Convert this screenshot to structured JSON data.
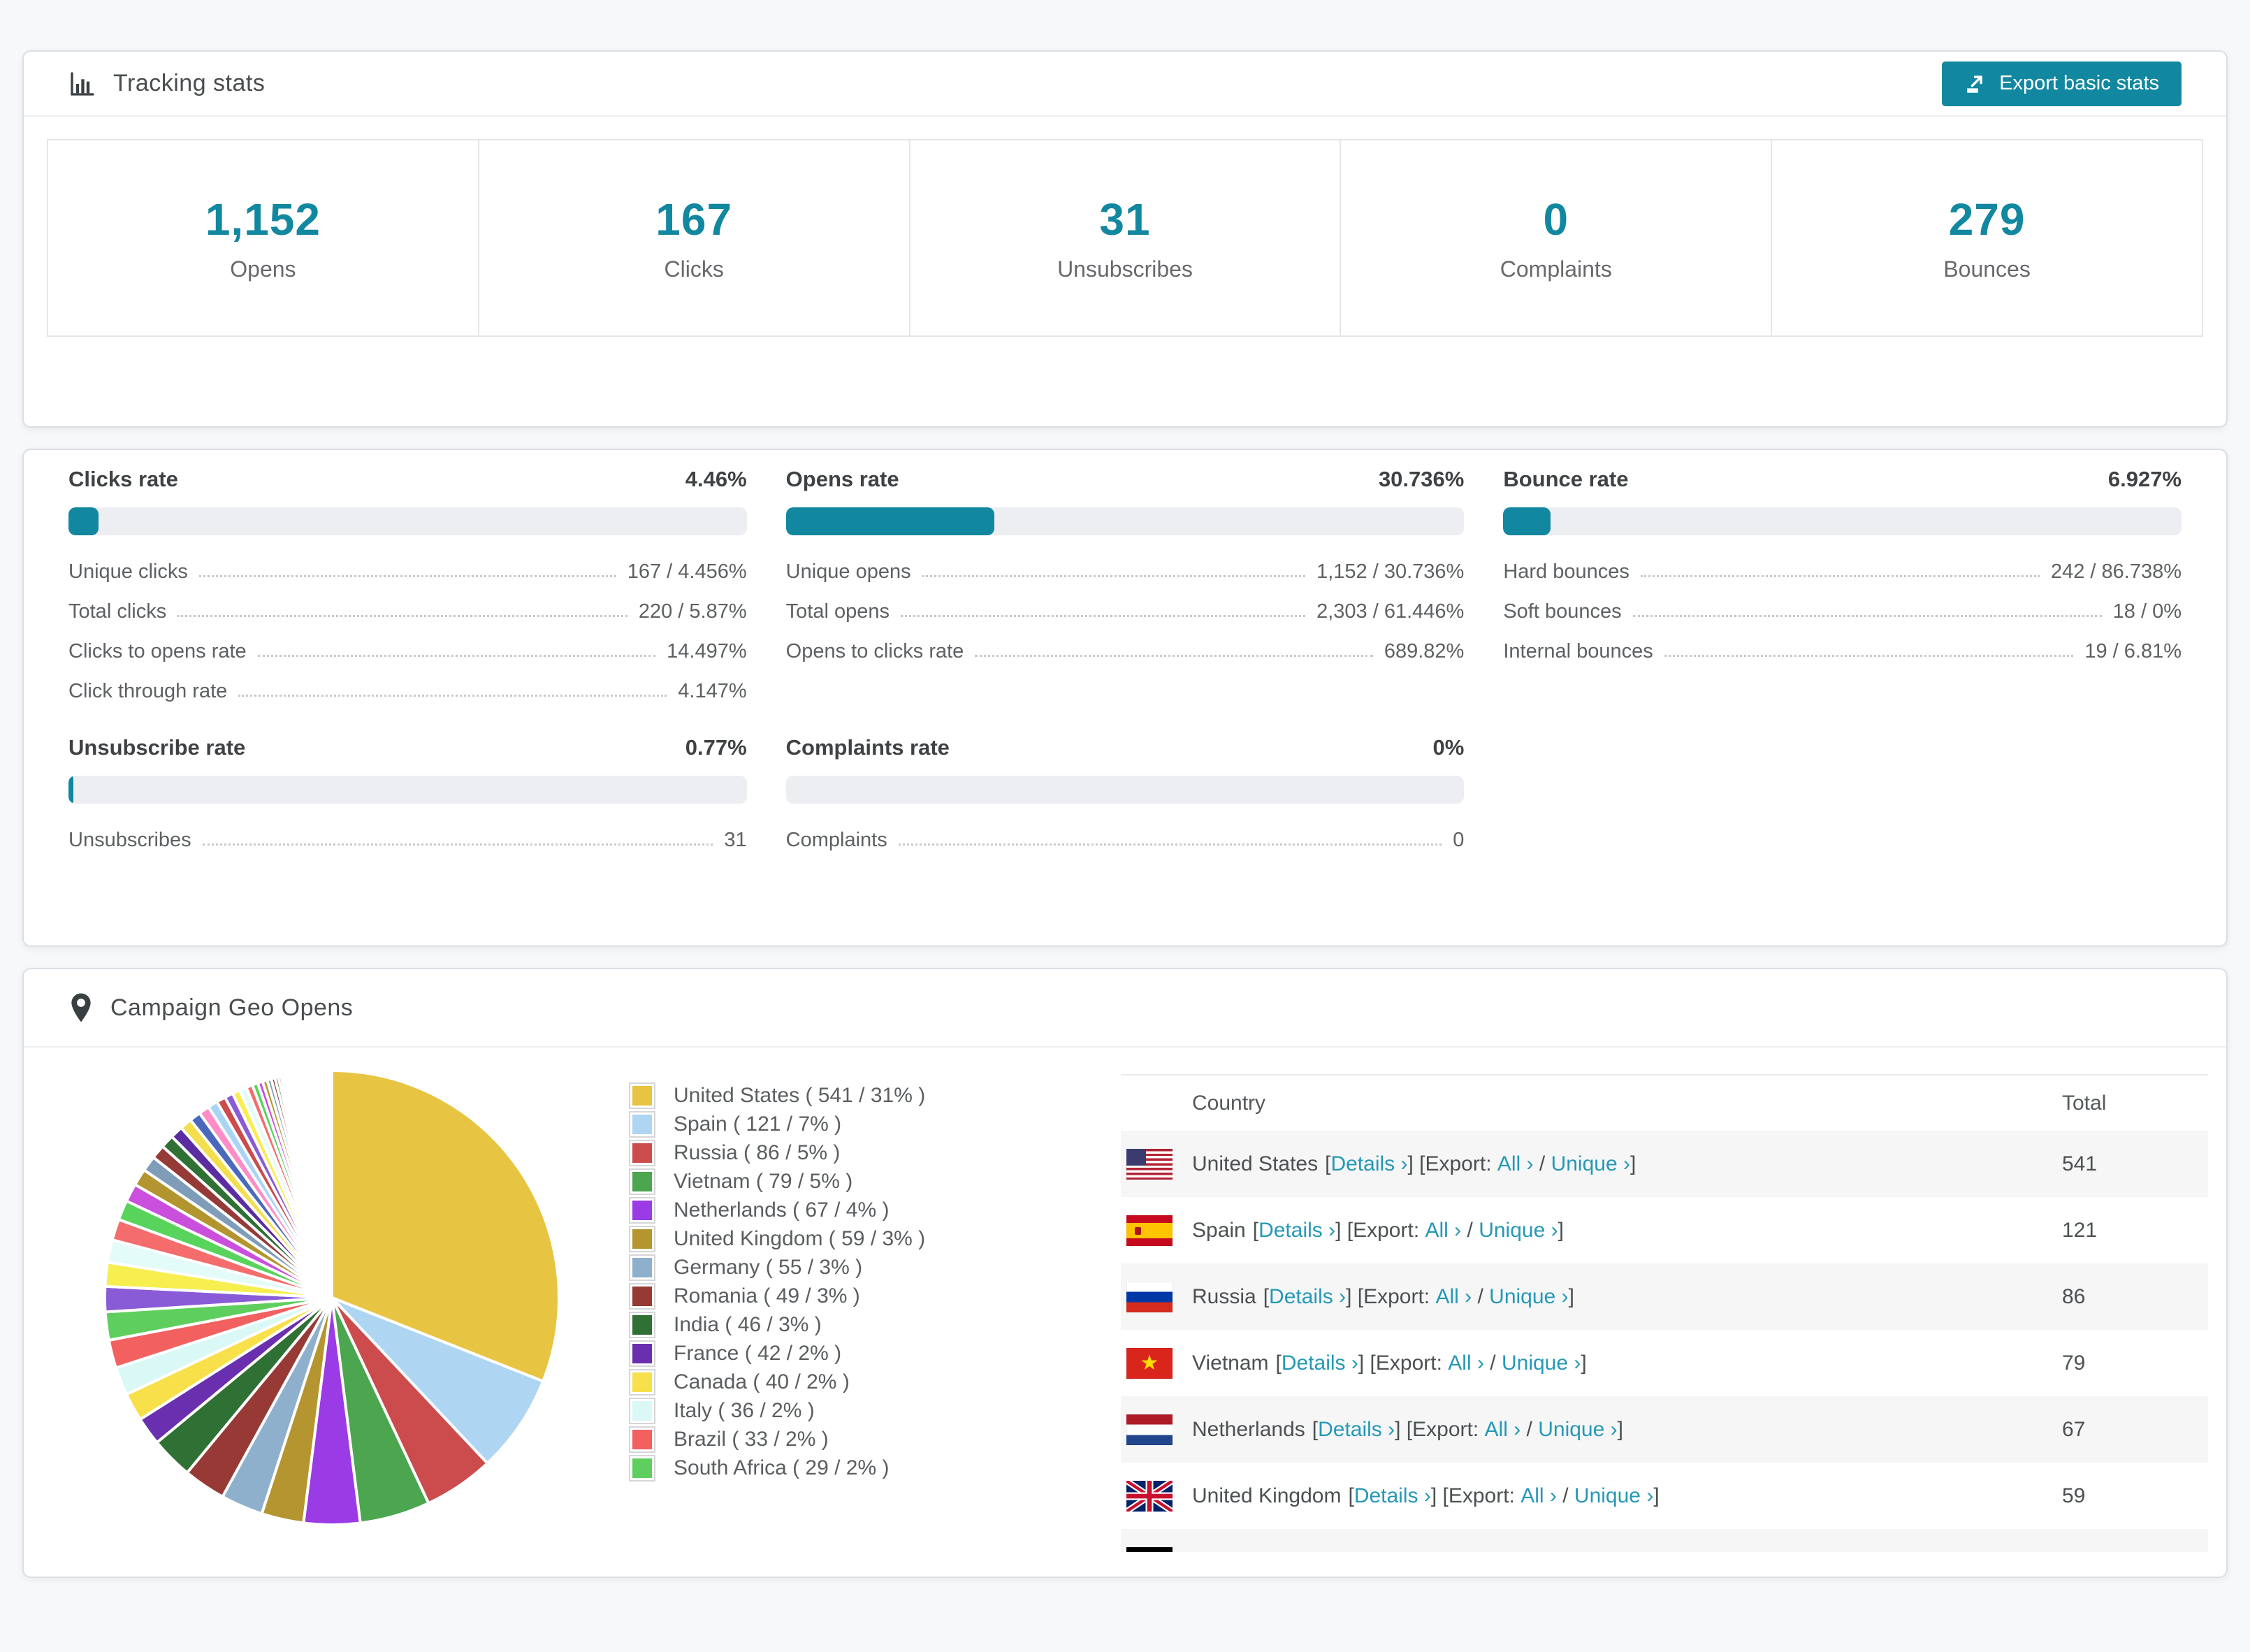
{
  "accent_color": "#1287a0",
  "page_bg": "#f7f8f9",
  "tracking": {
    "title": "Tracking stats",
    "icon": "bar-chart-icon",
    "export_button": "Export basic stats",
    "stats": [
      {
        "value": "1,152",
        "label": "Opens"
      },
      {
        "value": "167",
        "label": "Clicks"
      },
      {
        "value": "31",
        "label": "Unsubscribes"
      },
      {
        "value": "0",
        "label": "Complaints"
      },
      {
        "value": "279",
        "label": "Bounces"
      }
    ]
  },
  "rates": {
    "blocks": [
      {
        "title": "Clicks rate",
        "value": "4.46%",
        "percent": 4.46,
        "rows": [
          [
            "Unique clicks",
            "167 / 4.456%"
          ],
          [
            "Total clicks",
            "220 / 5.87%"
          ],
          [
            "Clicks to opens rate",
            "14.497%"
          ],
          [
            "Click through rate",
            "4.147%"
          ]
        ]
      },
      {
        "title": "Opens rate",
        "value": "30.736%",
        "percent": 30.736,
        "rows": [
          [
            "Unique opens",
            "1,152 / 30.736%"
          ],
          [
            "Total opens",
            "2,303 / 61.446%"
          ],
          [
            "Opens to clicks rate",
            "689.82%"
          ]
        ]
      },
      {
        "title": "Bounce rate",
        "value": "6.927%",
        "percent": 6.927,
        "rows": [
          [
            "Hard bounces",
            "242 / 86.738%"
          ],
          [
            "Soft bounces",
            "18 / 0%"
          ],
          [
            "Internal bounces",
            "19 / 6.81%"
          ]
        ]
      },
      {
        "title": "Unsubscribe rate",
        "value": "0.77%",
        "percent": 0.77,
        "rows": [
          [
            "Unsubscribes",
            "31"
          ]
        ]
      },
      {
        "title": "Complaints rate",
        "value": "0%",
        "percent": 0,
        "rows": [
          [
            "Complaints",
            "0"
          ]
        ]
      }
    ]
  },
  "geo": {
    "title": "Campaign Geo Opens",
    "icon": "map-pin-icon",
    "chart_data": {
      "type": "pie",
      "title": "Campaign Geo Opens",
      "legend_position": "right",
      "start_angle_deg": -90,
      "direction": "clockwise",
      "labels": [
        "United States",
        "Spain",
        "Russia",
        "Vietnam",
        "Netherlands",
        "United Kingdom",
        "Germany",
        "Romania",
        "India",
        "France",
        "Canada",
        "Italy",
        "Brazil",
        "South Africa"
      ],
      "values": [
        541,
        121,
        86,
        79,
        67,
        59,
        55,
        49,
        46,
        42,
        40,
        36,
        33,
        29
      ],
      "percents": [
        31,
        7,
        5,
        5,
        4,
        3,
        3,
        3,
        3,
        2,
        2,
        2,
        2,
        2
      ],
      "colors": [
        "#e8c443",
        "#aed5f2",
        "#cc4b4c",
        "#4ba64f",
        "#9a3be6",
        "#b5952f",
        "#8fb0cd",
        "#973a36",
        "#2f7034",
        "#6a2fae",
        "#f7e04a",
        "#d9f8f6",
        "#f26060",
        "#5ecf5e"
      ],
      "other_slices_note": "many small unlabeled slices tapering toward 12 o'clock, ~25% of pie total",
      "other_values": [
        1.8,
        1.7,
        1.6,
        1.5,
        1.4,
        1.3,
        1.2,
        1.1,
        1.0,
        0.95,
        0.9,
        0.85,
        0.8,
        0.75,
        0.7,
        0.65,
        0.6,
        0.55,
        0.5,
        0.45,
        0.4,
        0.36,
        0.33,
        0.3,
        0.27,
        0.24,
        0.21,
        0.19,
        0.17,
        0.15,
        0.13,
        0.11,
        0.1,
        0.09,
        0.08,
        0.07,
        0.06,
        0.05,
        0.05,
        0.04,
        0.04,
        0.03,
        0.03,
        0.02,
        0.02,
        0.02
      ],
      "other_colors": [
        "#8a5bd6",
        "#f7ee4f",
        "#e3fbf9",
        "#f46c6c",
        "#58d35b",
        "#cb4fdd",
        "#b3952f",
        "#7f9db9",
        "#963a38",
        "#2f7034",
        "#5b2da0",
        "#f3df4e",
        "#4a69bd",
        "#ff8cc6",
        "#aad4f5",
        "#cc4b4c"
      ],
      "legend_format": "{label} ( {value} / {percent}% )"
    },
    "table": {
      "headers": [
        "Country",
        "Total"
      ],
      "link_labels": {
        "details": "Details ›",
        "all": "All ›",
        "unique": "Unique ›"
      },
      "static_text": {
        "open_bracket": "[",
        "close_export": "] [Export: ",
        "slash": " / ",
        "close_bracket": "]"
      },
      "rows": [
        {
          "country": "United States",
          "flag": "us",
          "total": "541"
        },
        {
          "country": "Spain",
          "flag": "es",
          "total": "121"
        },
        {
          "country": "Russia",
          "flag": "ru",
          "total": "86"
        },
        {
          "country": "Vietnam",
          "flag": "vn",
          "total": "79"
        },
        {
          "country": "Netherlands",
          "flag": "nl",
          "total": "67"
        },
        {
          "country": "United Kingdom",
          "flag": "gb",
          "total": "59"
        },
        {
          "country": "",
          "flag": "de",
          "total": "",
          "clipped": true
        }
      ]
    }
  }
}
